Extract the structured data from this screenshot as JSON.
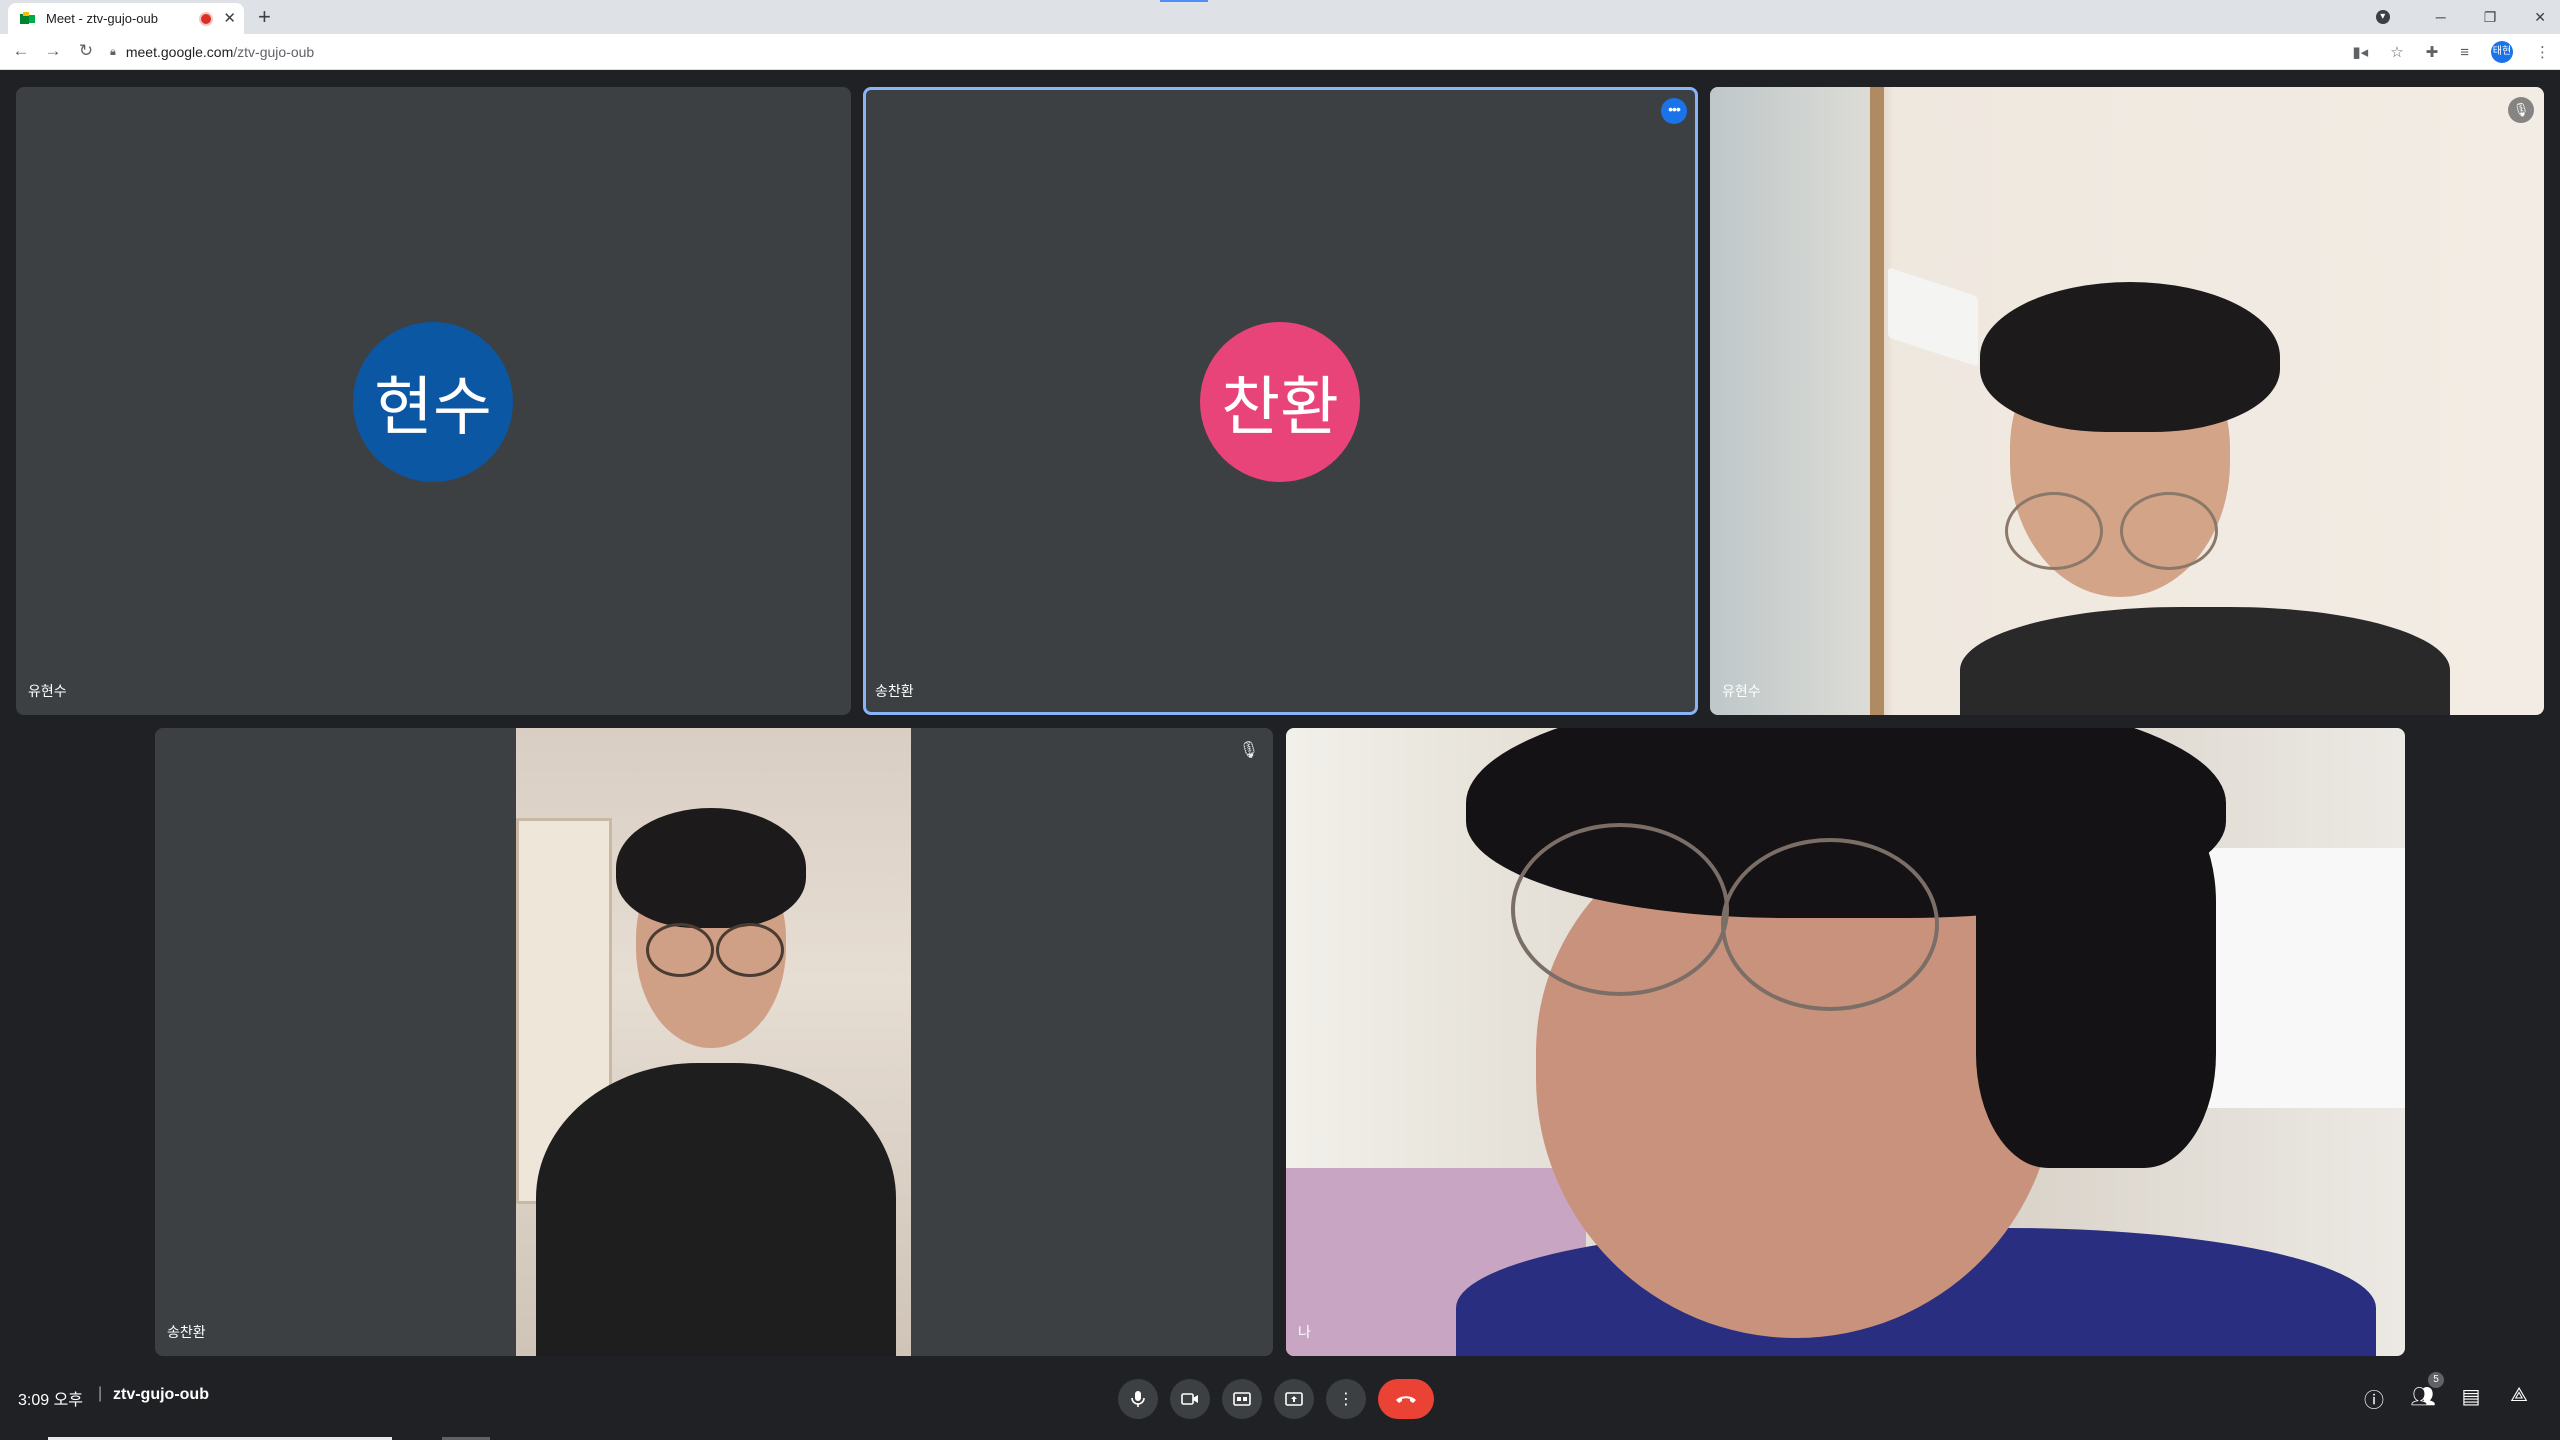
{
  "browser": {
    "tab_title": "Meet - ztv-gujo-oub",
    "new_tab_label": "+",
    "url_host": "meet.google.com",
    "url_path": "/ztv-gujo-oub",
    "profile_initials": "태현"
  },
  "tiles": [
    {
      "name": "유현수",
      "avatar_text": "현수",
      "avatar_color": "#0b57a4",
      "video": false,
      "active": false
    },
    {
      "name": "송찬환",
      "avatar_text": "찬환",
      "avatar_color": "#e8447a",
      "video": false,
      "active": true,
      "more_label": "•••"
    },
    {
      "name": "유현수",
      "video": true,
      "muted": true
    },
    {
      "name": "송찬환",
      "video": true,
      "muted": true
    },
    {
      "name": "나",
      "video": true
    }
  ],
  "bottom_bar": {
    "time": "3:09 오후",
    "separator": "|",
    "meeting_code": "ztv-gujo-oub",
    "participant_count": "5"
  },
  "icons": {
    "mic": "mic-icon",
    "camera": "camera-icon",
    "captions": "captions-icon",
    "present": "present-icon",
    "more": "more-vert-icon",
    "end_call": "end-call-icon",
    "info": "info-icon",
    "people": "people-icon",
    "chat": "chat-icon",
    "activities": "activities-icon"
  },
  "colors": {
    "background": "#202124",
    "tile": "#3c4043",
    "end_call": "#ea4335",
    "active_border": "#8ab4f8"
  }
}
